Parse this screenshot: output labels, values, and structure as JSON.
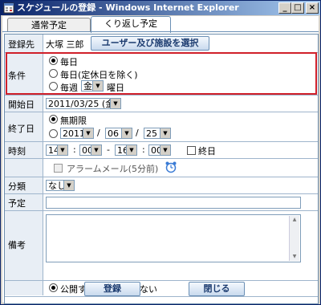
{
  "window": {
    "title": "スケジュールの登録 - Windows Internet Explorer",
    "controls": {
      "minimize": "_",
      "maximize": "□",
      "close": "×"
    }
  },
  "tabs": [
    {
      "label": "通常予定"
    },
    {
      "label": "くり返し予定"
    }
  ],
  "registrant": {
    "label": "登録先",
    "name": "大塚 三郎",
    "select_button": "ユーザー及び施設を選択"
  },
  "condition": {
    "label": "条件",
    "options": [
      {
        "label": "毎日",
        "selected": true
      },
      {
        "label": "毎日(定休日を除く)",
        "selected": false
      },
      {
        "label": "毎週",
        "selected": false
      }
    ],
    "weekday_value": "金",
    "weekday_suffix": "曜日"
  },
  "start_date": {
    "label": "開始日",
    "value": "2011/03/25 (金)"
  },
  "end_date": {
    "label": "終了日",
    "options": [
      {
        "label": "無期限",
        "selected": true
      },
      {
        "label": "",
        "selected": false
      }
    ],
    "year": "2011",
    "month": "06",
    "day": "25",
    "sep": "/"
  },
  "time": {
    "label": "時刻",
    "start_hour": "14",
    "start_min": "00",
    "end_hour": "16",
    "end_min": "00",
    "colon": ":",
    "dash": "-",
    "allday_label": "終日"
  },
  "alarm": {
    "label": "アラームメール(5分前)",
    "icon": "alarm-clock-icon"
  },
  "category": {
    "label": "分類",
    "value": "なし"
  },
  "plan": {
    "label": "予定",
    "value": ""
  },
  "memo": {
    "label": "備考",
    "value": "",
    "scroll_up": "▲",
    "scroll_down": "▼"
  },
  "visibility": {
    "public": "公開する",
    "private": "公開しない",
    "selected": "public"
  },
  "actions": {
    "register": "登録",
    "close": "閉じる"
  },
  "colors": {
    "highlight": "#d0202a",
    "accent": "#6a8fb5",
    "title_bar": "#0a246a"
  }
}
